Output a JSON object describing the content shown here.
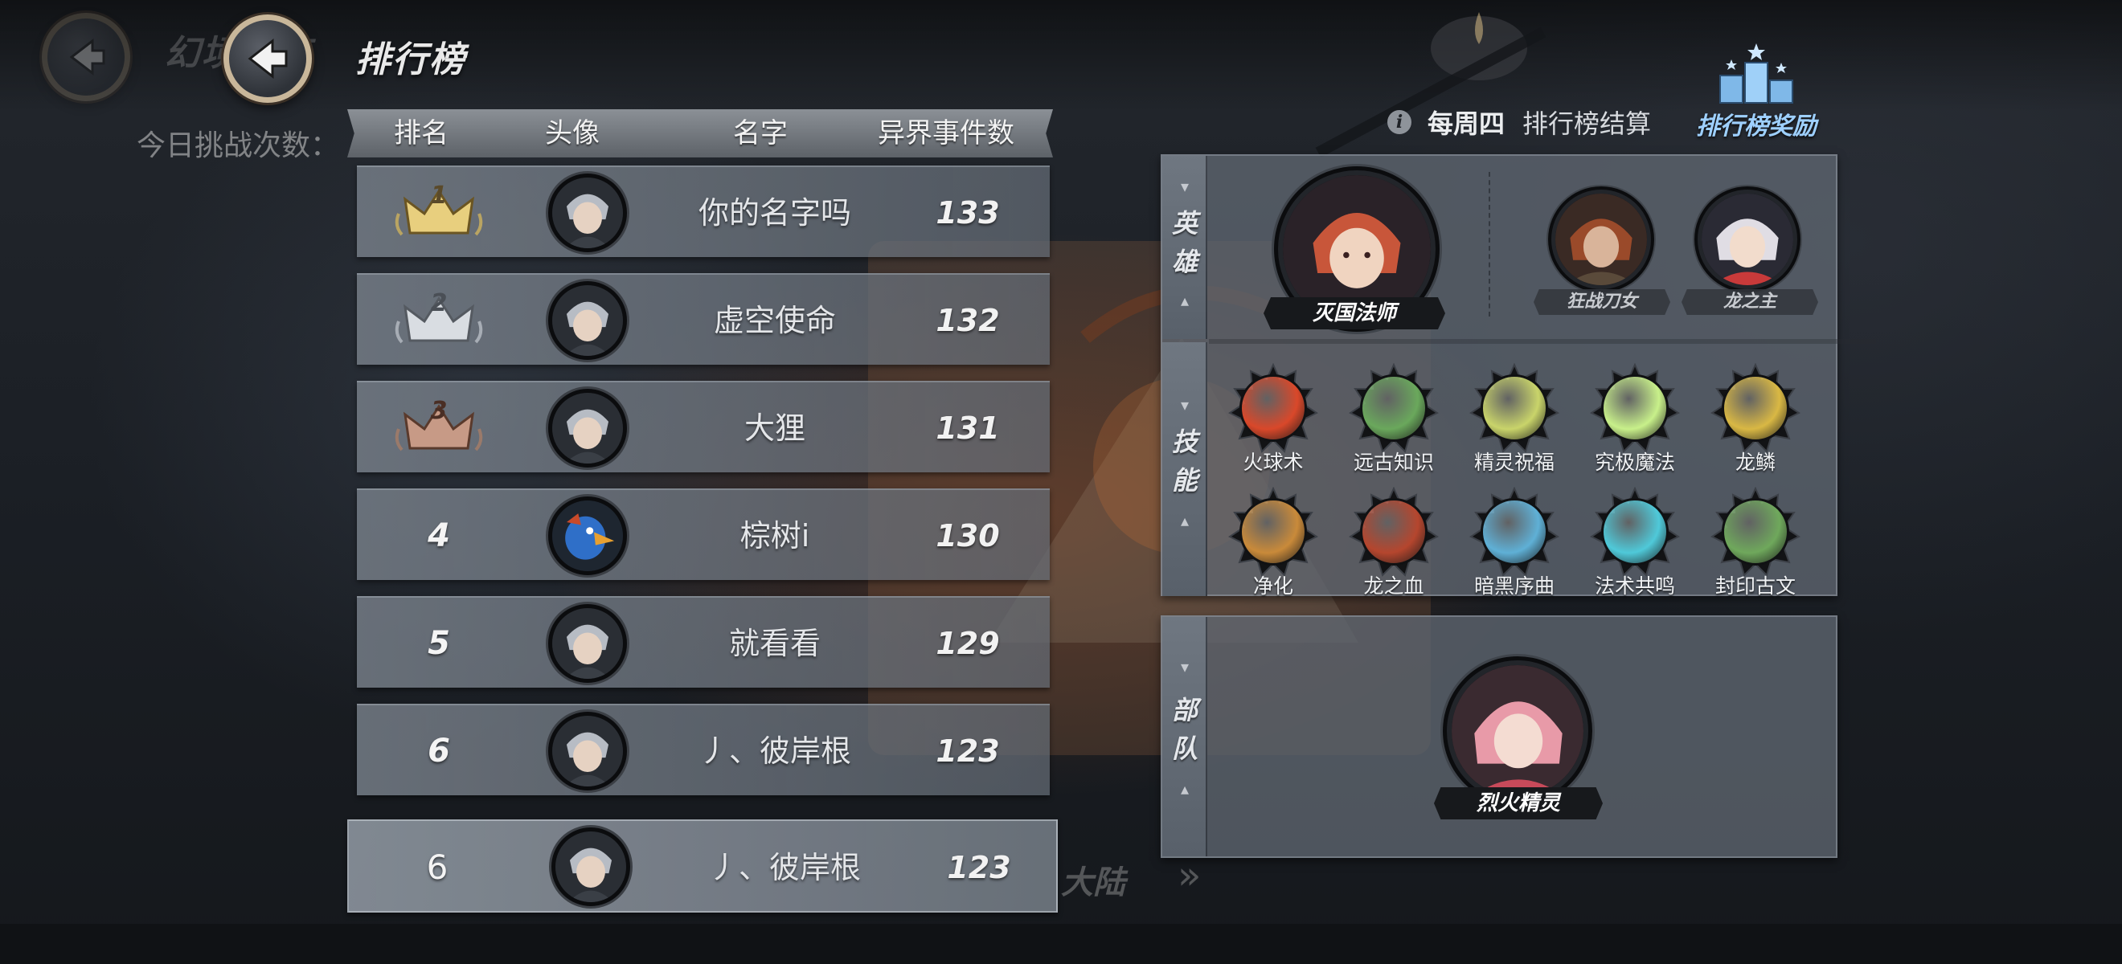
{
  "header": {
    "title": "排行榜",
    "ghost_title": "幻境试炼",
    "ghost_challenge": "今日挑战次数："
  },
  "table": {
    "columns": [
      "排名",
      "头像",
      "名字",
      "异界事件数"
    ],
    "rows": [
      {
        "rank": "1",
        "name": "你的名字吗",
        "count": "133",
        "crown": "gold"
      },
      {
        "rank": "2",
        "name": "虚空使命",
        "count": "132",
        "crown": "silver"
      },
      {
        "rank": "3",
        "name": "大狸",
        "count": "131",
        "crown": "bronze"
      },
      {
        "rank": "4",
        "name": "棕树i",
        "count": "130"
      },
      {
        "rank": "5",
        "name": "就看看",
        "count": "129"
      },
      {
        "rank": "6",
        "name": "丿、彼岸根",
        "count": "123"
      }
    ],
    "self": {
      "rank": "6",
      "name": "丿、彼岸根",
      "count": "123"
    }
  },
  "ghost_bottom": {
    "continent": "大陆",
    "chevron": "»"
  },
  "settlement": {
    "day": "每周四",
    "text": "排行榜结算"
  },
  "reward": {
    "label": "排行榜奖励",
    "icon": "podium-icon"
  },
  "lineup": {
    "hero_tab": "英雄",
    "skill_tab": "技能",
    "troop_tab": "部队",
    "main_hero": "灭国法师",
    "sub_heroes": [
      "狂战刀女",
      "龙之主"
    ],
    "skills_row1": [
      "火球术",
      "远古知识",
      "精灵祝福",
      "究极魔法",
      "龙鳞"
    ],
    "skills_row2": [
      "净化",
      "龙之血",
      "暗黑序曲",
      "法术共鸣",
      "封印古文"
    ],
    "troop": "烈火精灵"
  },
  "colors": {
    "gold": "#e8cf7e",
    "silver": "#d9dde2",
    "bronze": "#c79a86",
    "reward_text": "#9ed0ff",
    "skill_cores_row1": [
      "#d9482a",
      "#6aa85c",
      "#c9d46a",
      "#c8f08a",
      "#d9b844"
    ],
    "skill_cores_row2": [
      "#c98a3a",
      "#b5462e",
      "#5fb0d6",
      "#4fc9d9",
      "#6fa85c"
    ]
  }
}
